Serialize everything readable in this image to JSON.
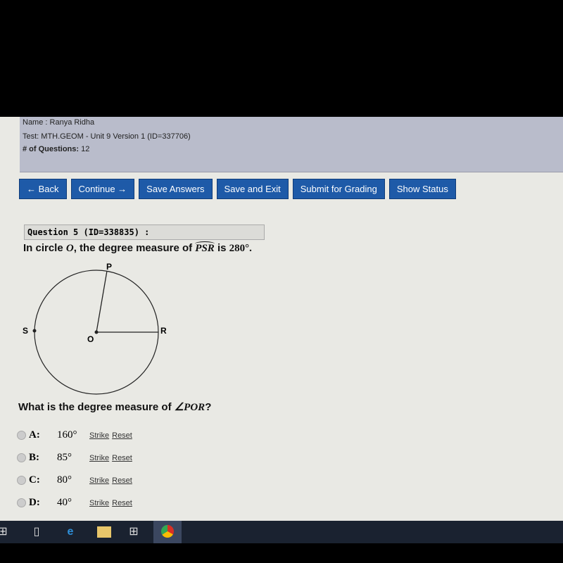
{
  "header": {
    "name": "Name : Ranya Ridha",
    "test": "Test:  MTH.GEOM - Unit 9 Version 1 (ID=337706)",
    "questions_label": "# of Questions:",
    "questions_count": "12"
  },
  "toolbar": {
    "back": "← Back",
    "continue": "Continue →",
    "save": "Save Answers",
    "save_exit": "Save and Exit",
    "submit": "Submit for Grading",
    "status": "Show Status"
  },
  "question": {
    "header": "Question 5 (ID=338835) :",
    "stem_pre": "In circle ",
    "stem_circle": "O",
    "stem_mid": ", the degree measure of ",
    "arc": "PSR",
    "stem_is": " is ",
    "stem_value": "280°.",
    "prompt_pre": "What is the degree measure of ",
    "prompt_angle": "∠POR",
    "prompt_post": "?",
    "figure": {
      "P": "P",
      "S": "S",
      "O": "O",
      "R": "R"
    }
  },
  "choices": [
    {
      "label": "A:",
      "value": "160°",
      "strike": "Strike",
      "reset": "Reset"
    },
    {
      "label": "B:",
      "value": "85°",
      "strike": "Strike",
      "reset": "Reset"
    },
    {
      "label": "C:",
      "value": "80°",
      "strike": "Strike",
      "reset": "Reset"
    },
    {
      "label": "D:",
      "value": "40°",
      "strike": "Strike",
      "reset": "Reset"
    }
  ],
  "taskbar": {
    "icons": [
      "windows-start-icon",
      "task-view-icon",
      "edge-icon",
      "file-explorer-icon",
      "store-icon",
      "chrome-icon"
    ]
  }
}
